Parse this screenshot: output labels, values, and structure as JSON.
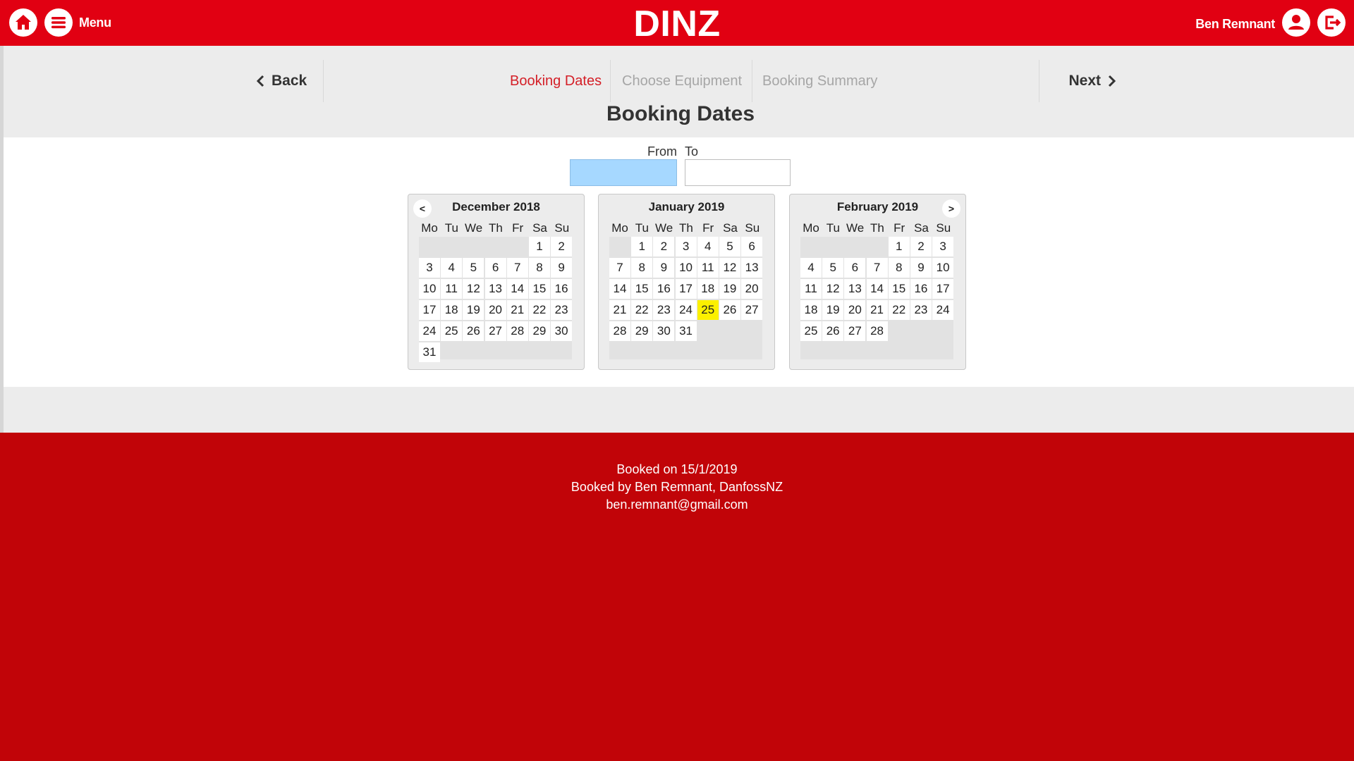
{
  "header": {
    "menu_label": "Menu",
    "brand": "DINZ",
    "user_name": "Ben Remnant",
    "brand_color": "#e10012"
  },
  "steps": {
    "back_label": "Back",
    "next_label": "Next",
    "items": [
      {
        "label": "Booking Dates",
        "active": true
      },
      {
        "label": "Choose Equipment",
        "active": false
      },
      {
        "label": "Booking Summary",
        "active": false
      }
    ]
  },
  "page": {
    "title": "Booking Dates"
  },
  "date_range": {
    "from_label": "From",
    "to_label": "To",
    "from_value": "",
    "to_value": ""
  },
  "calendars": [
    {
      "title": "December 2018",
      "nav_prev": "<",
      "offset": 5,
      "days": 31,
      "highlight": null
    },
    {
      "title": "January 2019",
      "offset": 1,
      "days": 31,
      "highlight": 25
    },
    {
      "title": "February 2019",
      "nav_next": ">",
      "offset": 4,
      "days": 28,
      "highlight": null
    }
  ],
  "weekdays": [
    "Mo",
    "Tu",
    "We",
    "Th",
    "Fr",
    "Sa",
    "Su"
  ],
  "footer": {
    "booked_on": "Booked on 15/1/2019",
    "booked_by": "Booked by Ben Remnant, DanfossNZ",
    "email": "ben.remnant@gmail.com"
  },
  "colors": {
    "header_red": "#e10012",
    "footer_red": "#c10408",
    "active_step": "#d41f27",
    "today_highlight": "#fcf000",
    "from_input_bg": "#a6d8ff"
  }
}
